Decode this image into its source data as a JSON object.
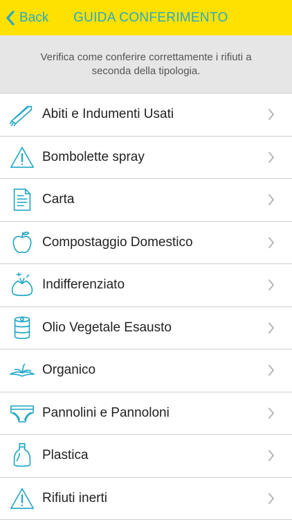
{
  "navbar": {
    "back_label": "Back",
    "title": "GUIDA CONFERIMENTO",
    "background": "#ffe100",
    "accent": "#27a9c7"
  },
  "intro": {
    "text": "Verifica come conferire correttamente i rifiuti a seconda della tipologia."
  },
  "categories": [
    {
      "label": "Abiti e Indumenti Usati",
      "icon": "clothes-hanger-icon"
    },
    {
      "label": "Bombolette spray",
      "icon": "warning-triangle-icon"
    },
    {
      "label": "Carta",
      "icon": "paper-sheet-icon"
    },
    {
      "label": "Compostaggio Domestico",
      "icon": "apple-core-icon"
    },
    {
      "label": "Indifferenziato",
      "icon": "trash-bag-icon"
    },
    {
      "label": "Olio Vegetale Esausto",
      "icon": "oil-can-icon"
    },
    {
      "label": "Organico",
      "icon": "banana-peel-icon"
    },
    {
      "label": "Pannolini e Pannoloni",
      "icon": "diaper-icon"
    },
    {
      "label": "Plastica",
      "icon": "plastic-bottle-icon"
    },
    {
      "label": "Rifiuti inerti",
      "icon": "warning-triangle-icon"
    }
  ]
}
